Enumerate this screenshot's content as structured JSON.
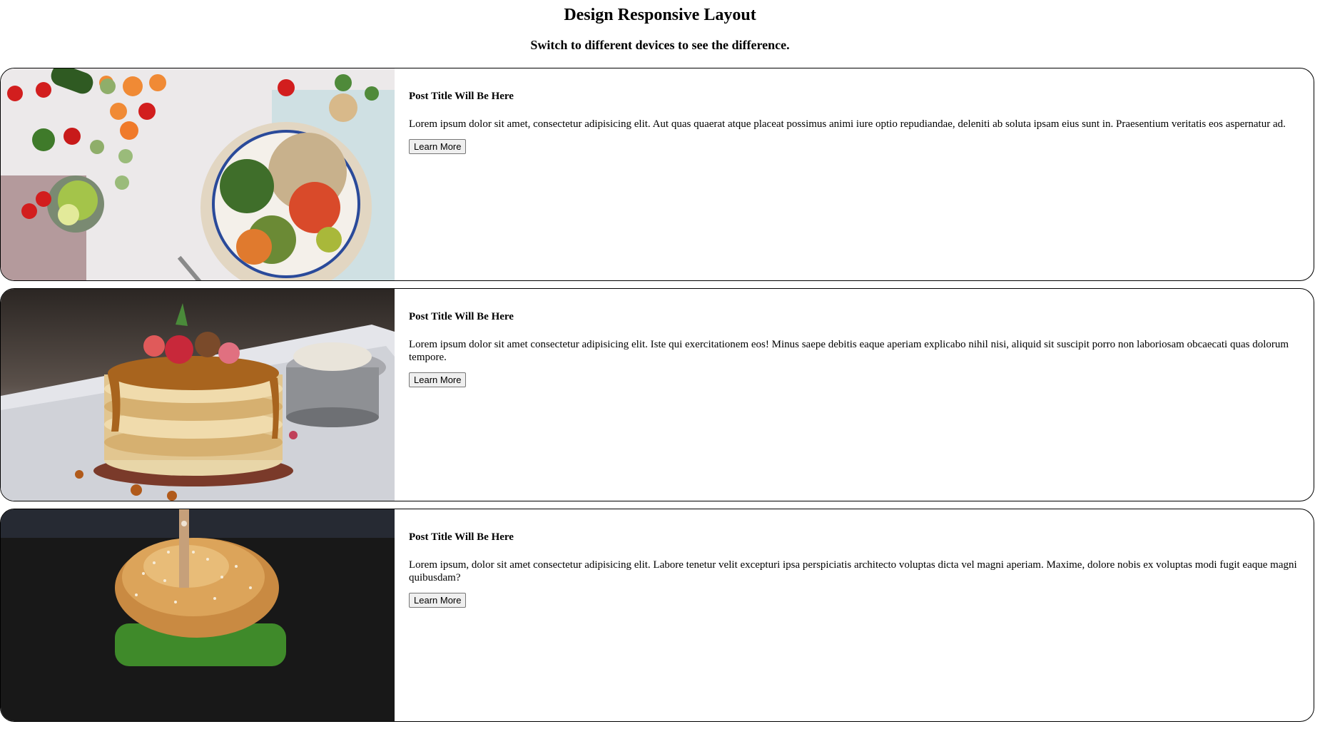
{
  "header": {
    "title": "Design Responsive Layout",
    "subtitle": "Switch to different devices to see the difference."
  },
  "posts": [
    {
      "title": "Post Title Will Be Here",
      "text": "Lorem ipsum dolor sit amet, consectetur adipisicing elit. Aut quas quaerat atque placeat possimus animi iure optio repudiandae, deleniti ab soluta ipsam eius sunt in. Praesentium veritatis eos aspernatur ad.",
      "button_label": "Learn More",
      "image": "vegetable-bowl-photo"
    },
    {
      "title": "Post Title Will Be Here",
      "text": "Lorem ipsum dolor sit amet consectetur adipisicing elit. Iste qui exercitationem eos! Minus saepe debitis eaque aperiam explicabo nihil nisi, aliquid sit suscipit porro non laboriosam obcaecati quas dolorum tempore.",
      "button_label": "Learn More",
      "image": "pancake-stack-photo"
    },
    {
      "title": "Post Title Will Be Here",
      "text": "Lorem ipsum, dolor sit amet consectetur adipisicing elit. Labore tenetur velit excepturi ipsa perspiciatis architecto voluptas dicta vel magni aperiam. Maxime, dolore nobis ex voluptas modi fugit eaque magni quibusdam?",
      "button_label": "Learn More",
      "image": "burger-photo"
    }
  ]
}
